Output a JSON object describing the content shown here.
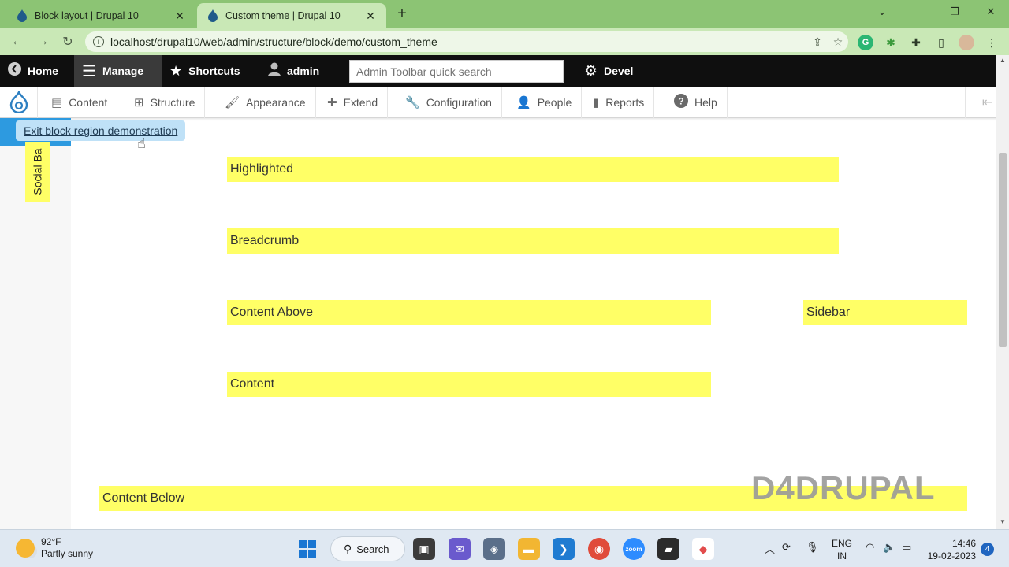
{
  "browser": {
    "tabs": [
      {
        "title": "Block layout | Drupal 10",
        "active": false
      },
      {
        "title": "Custom theme | Drupal 10",
        "active": true
      }
    ],
    "url": "localhost/drupal10/web/admin/structure/block/demo/custom_theme"
  },
  "toolbar": {
    "home": "Home",
    "manage": "Manage",
    "shortcuts": "Shortcuts",
    "user": "admin",
    "search_placeholder": "Admin Toolbar quick search",
    "devel": "Devel"
  },
  "tray": {
    "items": [
      "Content",
      "Structure",
      "Appearance",
      "Extend",
      "Configuration",
      "People",
      "Reports",
      "Help"
    ]
  },
  "page": {
    "exit_link": "Exit block region demonstration",
    "social_bar": "Social Ba",
    "regions": {
      "highlighted": "Highlighted",
      "breadcrumb": "Breadcrumb",
      "content_above": "Content Above",
      "sidebar": "Sidebar",
      "content": "Content",
      "content_below": "Content Below"
    },
    "watermark": "D4DRUPAL"
  },
  "colors": {
    "region": "#ffff66",
    "admin_toolbar": "#0f0f0f",
    "accent": "#2d9ae0"
  },
  "taskbar": {
    "weather_temp": "92°F",
    "weather_desc": "Partly sunny",
    "search_label": "Search",
    "lang_line1": "ENG",
    "lang_line2": "IN",
    "time": "14:46",
    "date": "19-02-2023",
    "notifications": "4"
  }
}
